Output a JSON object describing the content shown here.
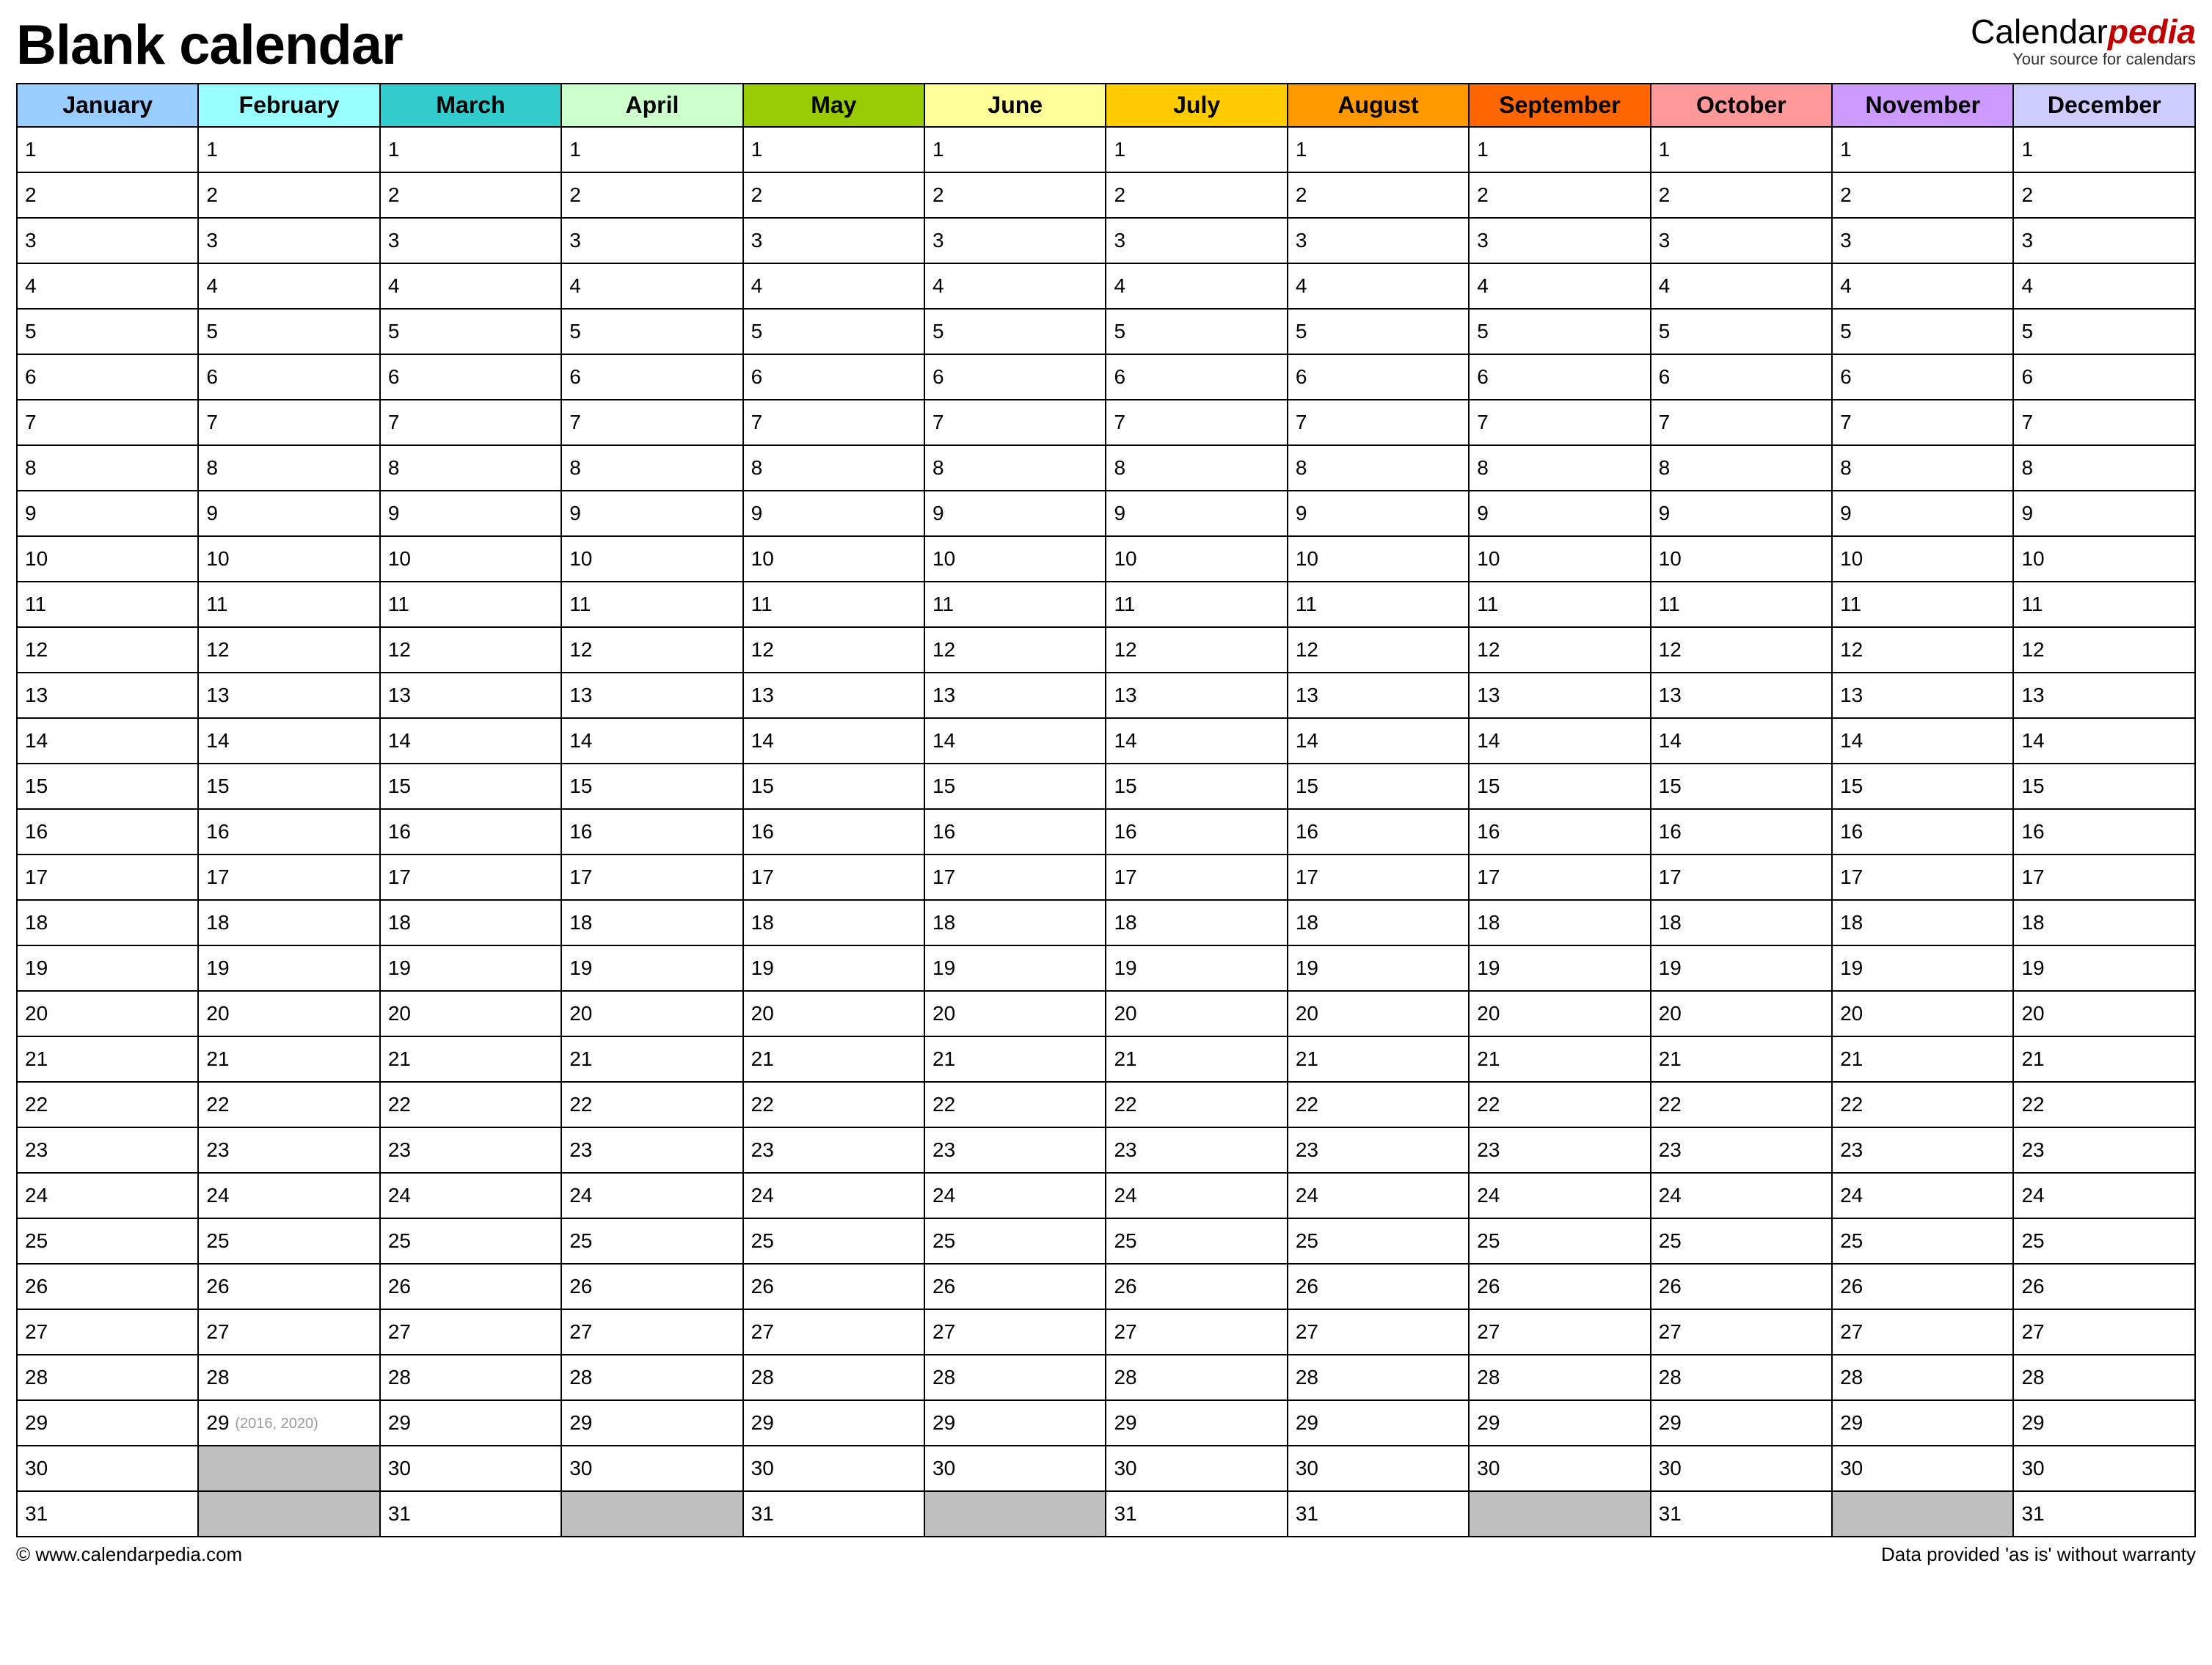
{
  "header": {
    "title": "Blank calendar",
    "logo_prefix": "Calendar",
    "logo_suffix": "pedia",
    "logo_tagline": "Your source for calendars"
  },
  "months": [
    {
      "name": "January",
      "color": "#99ccff",
      "days": 31
    },
    {
      "name": "February",
      "color": "#99ffff",
      "days": 29,
      "leap": true
    },
    {
      "name": "March",
      "color": "#33cccc",
      "days": 31
    },
    {
      "name": "April",
      "color": "#ccffcc",
      "days": 30
    },
    {
      "name": "May",
      "color": "#99cc00",
      "days": 31
    },
    {
      "name": "June",
      "color": "#ffff99",
      "days": 30
    },
    {
      "name": "July",
      "color": "#ffcc00",
      "days": 31
    },
    {
      "name": "August",
      "color": "#ff9900",
      "days": 31
    },
    {
      "name": "September",
      "color": "#ff6600",
      "days": 30
    },
    {
      "name": "October",
      "color": "#ff9999",
      "days": 31
    },
    {
      "name": "November",
      "color": "#cc99ff",
      "days": 30
    },
    {
      "name": "December",
      "color": "#ccccff",
      "days": 31
    }
  ],
  "max_rows": 31,
  "leap_note": "(2016, 2020)",
  "footer": {
    "left": "© www.calendarpedia.com",
    "right": "Data provided 'as is' without warranty"
  }
}
